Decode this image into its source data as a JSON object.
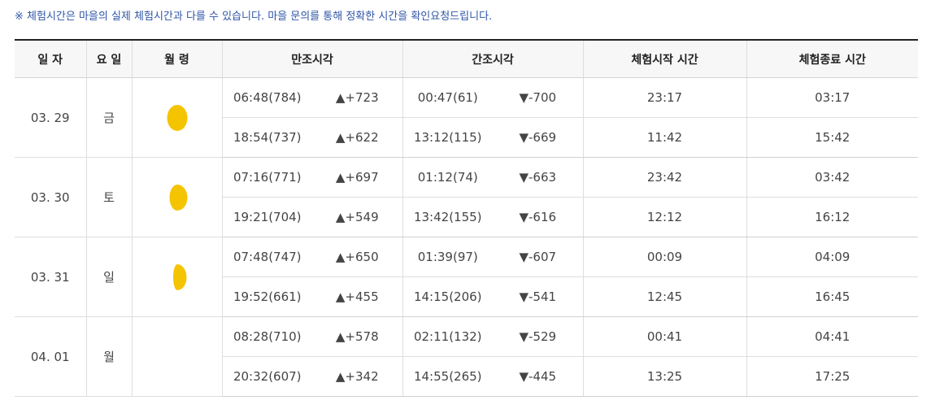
{
  "notice": "※ 체험시간은 마을의 실제 체험시간과 다를 수 있습니다. 마을 문의를 통해 정확한 시간을 확인요청드립니다.",
  "headers": {
    "date": "일 자",
    "day": "요 일",
    "moon": "월 령",
    "high": "만조시각",
    "low": "간조시각",
    "start": "체험시작 시간",
    "end": "체험종료 시간"
  },
  "colors": {
    "up": "#e01b1b",
    "down": "#1f3ec4",
    "moon": "#f5c400",
    "notice": "#2e55a5"
  },
  "rows": [
    {
      "date": "03. 29",
      "day": "금",
      "moon_icon": "moon-icon",
      "moon_lit": 1.0,
      "times": [
        {
          "high": "06:48(784)",
          "high_delta": "▲+723",
          "low": "00:47(61)",
          "low_delta": "▼-700",
          "start": "23:17",
          "end": "03:17"
        },
        {
          "high": "18:54(737)",
          "high_delta": "▲+622",
          "low": "13:12(115)",
          "low_delta": "▼-669",
          "start": "11:42",
          "end": "15:42"
        }
      ]
    },
    {
      "date": "03. 30",
      "day": "토",
      "moon_icon": "moon-icon",
      "moon_lit": 0.85,
      "times": [
        {
          "high": "07:16(771)",
          "high_delta": "▲+697",
          "low": "01:12(74)",
          "low_delta": "▼-663",
          "start": "23:42",
          "end": "03:42"
        },
        {
          "high": "19:21(704)",
          "high_delta": "▲+549",
          "low": "13:42(155)",
          "low_delta": "▼-616",
          "start": "12:12",
          "end": "16:12"
        }
      ]
    },
    {
      "date": "03. 31",
      "day": "일",
      "moon_icon": "moon-icon",
      "moon_lit": 0.7,
      "times": [
        {
          "high": "07:48(747)",
          "high_delta": "▲+650",
          "low": "01:39(97)",
          "low_delta": "▼-607",
          "start": "00:09",
          "end": "04:09"
        },
        {
          "high": "19:52(661)",
          "high_delta": "▲+455",
          "low": "14:15(206)",
          "low_delta": "▼-541",
          "start": "12:45",
          "end": "16:45"
        }
      ]
    },
    {
      "date": "04. 01",
      "day": "월",
      "moon_icon": "",
      "moon_lit": 0,
      "times": [
        {
          "high": "08:28(710)",
          "high_delta": "▲+578",
          "low": "02:11(132)",
          "low_delta": "▼-529",
          "start": "00:41",
          "end": "04:41"
        },
        {
          "high": "20:32(607)",
          "high_delta": "▲+342",
          "low": "14:55(265)",
          "low_delta": "▼-445",
          "start": "13:25",
          "end": "17:25"
        }
      ]
    }
  ]
}
